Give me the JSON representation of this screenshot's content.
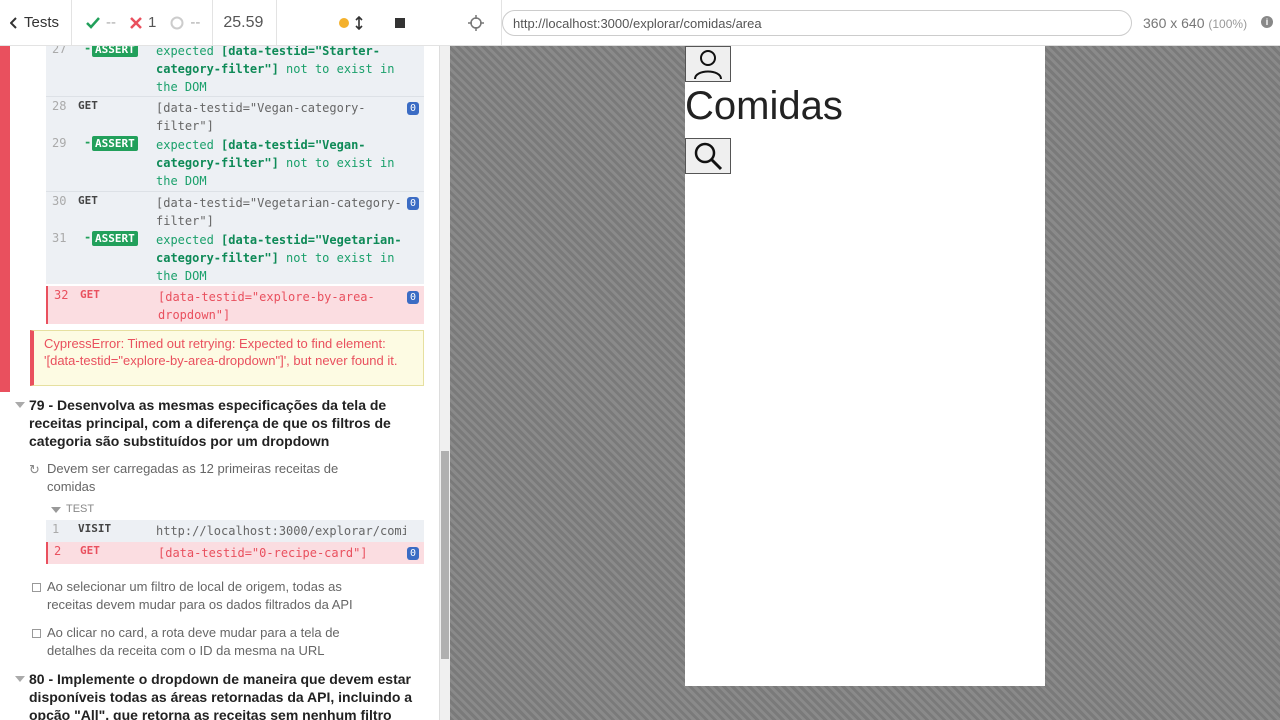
{
  "header": {
    "tests_label": "Tests",
    "passed": "--",
    "failed": "1",
    "pending": "--",
    "duration": "25.59"
  },
  "address": {
    "url": "http://localhost:3000/explorar/comidas/area",
    "viewport": "360 x 640",
    "zoom": "(100%)"
  },
  "commands_top": [
    {
      "num": "27",
      "name": "ASSERT",
      "type": "assert",
      "msg_pre": "expected ",
      "msg_b": "[data-testid=\"Starter-category-filter\"]",
      "msg_post": " not to exist in the DOM"
    },
    {
      "num": "28",
      "name": "GET",
      "type": "get",
      "msg": "[data-testid=\"Vegan-category-filter\"]",
      "badge": "0"
    },
    {
      "num": "29",
      "name": "ASSERT",
      "type": "assert",
      "msg_pre": "expected ",
      "msg_b": "[data-testid=\"Vegan-category-filter\"]",
      "msg_post": " not to exist in the DOM"
    },
    {
      "num": "30",
      "name": "GET",
      "type": "get",
      "msg": "[data-testid=\"Vegetarian-category-filter\"]",
      "badge": "0"
    },
    {
      "num": "31",
      "name": "ASSERT",
      "type": "assert",
      "msg_pre": "expected ",
      "msg_b": "[data-testid=\"Vegetarian-category-filter\"]",
      "msg_post": " not to exist in the DOM"
    },
    {
      "num": "32",
      "name": "GET",
      "type": "failed",
      "msg": "[data-testid=\"explore-by-area-dropdown\"]",
      "badge": "0"
    }
  ],
  "error": "CypressError: Timed out retrying: Expected to find element: '[data-testid=\"explore-by-area-dropdown\"]', but never found it.",
  "test79": {
    "title": "79 - Desenvolva as mesmas especificações da tela de receitas principal, com a diferença de que os filtros de categoria são substituídos por um dropdown",
    "sub1": "Devem ser carregadas as 12 primeiras receitas de comidas",
    "test_label": "TEST",
    "cmd1": {
      "num": "1",
      "name": "VISIT",
      "msg": "http://localhost:3000/explorar/comi…"
    },
    "cmd2": {
      "num": "2",
      "name": "GET",
      "msg": "[data-testid=\"0-recipe-card\"]",
      "badge": "0"
    },
    "sub2": "Ao selecionar um filtro de local de origem, todas as receitas devem mudar para os dados filtrados da API",
    "sub3": "Ao clicar no card, a rota deve mudar para a tela de detalhes da receita com o ID da mesma na URL"
  },
  "test80": {
    "title": "80 - Implemente o dropdown de maneira que devem estar disponíveis todas as áreas retornadas da API, incluindo a opção \"All\", que retorna as receitas sem nenhum filtro"
  },
  "app": {
    "title": "Comidas"
  },
  "colors": {
    "fail": "#e9505e",
    "pass": "#22a05b",
    "badge": "#3b6cc4"
  }
}
